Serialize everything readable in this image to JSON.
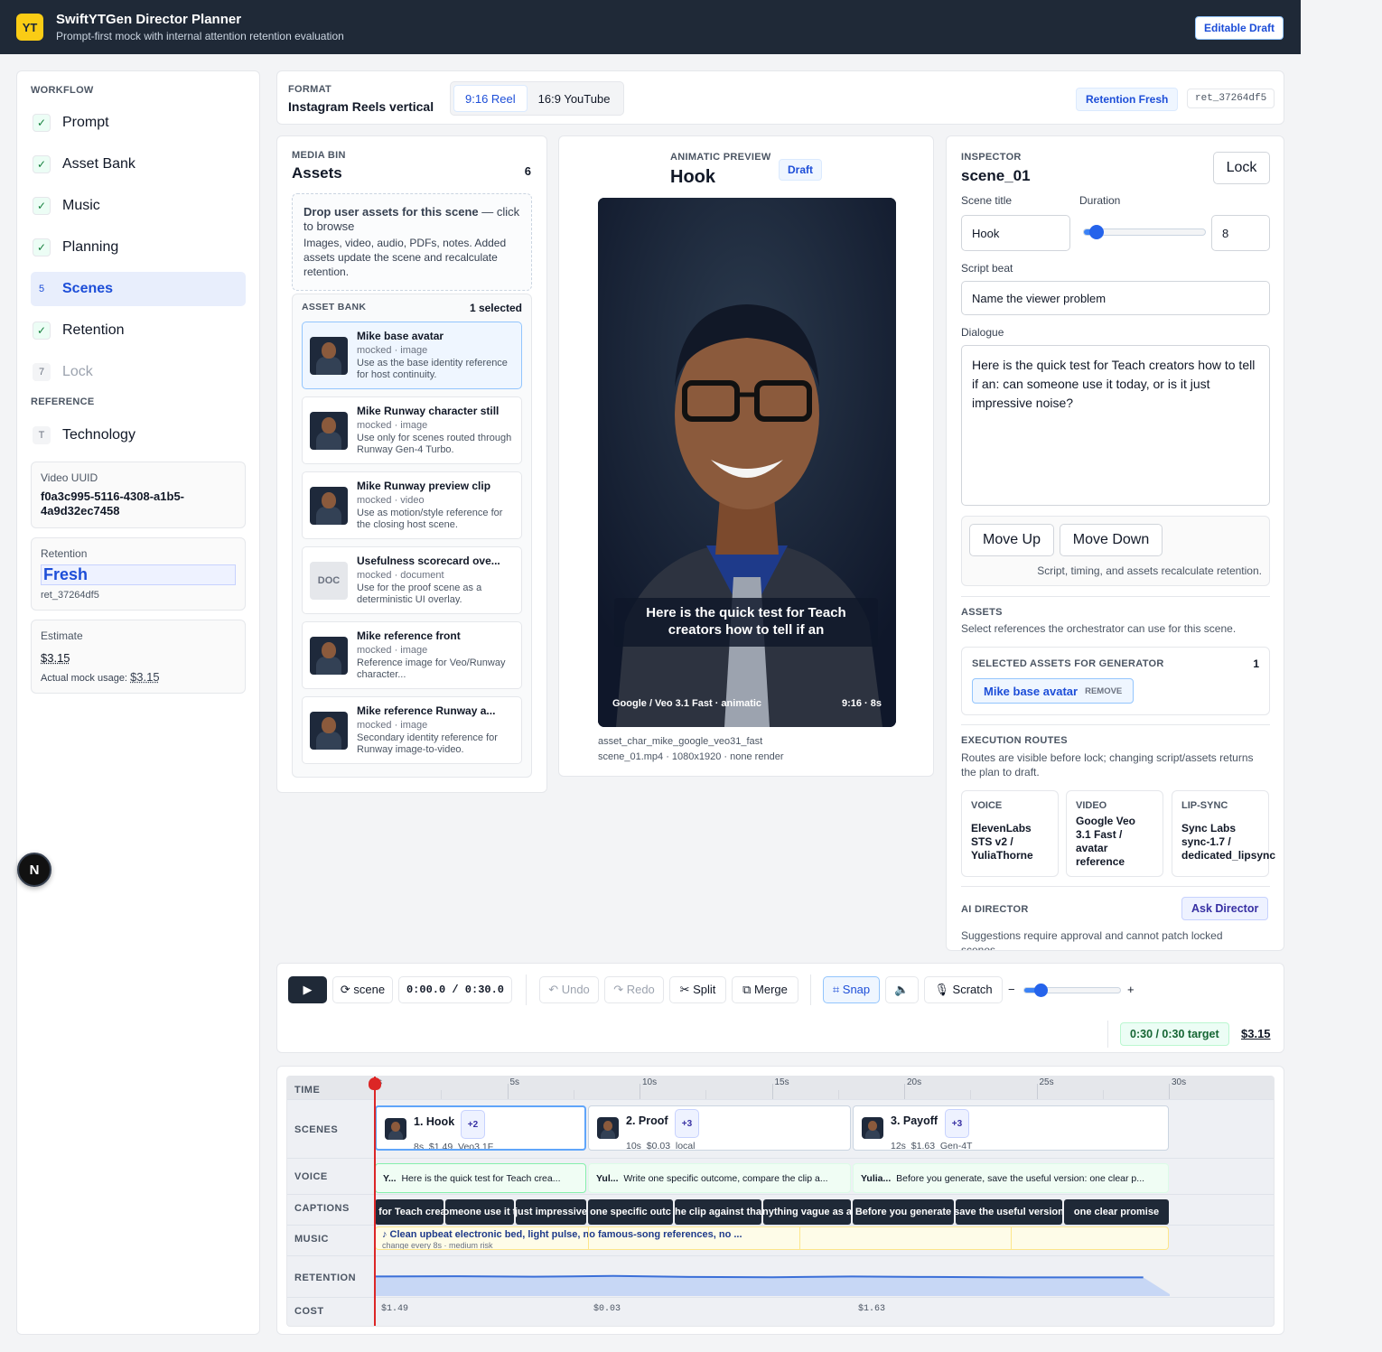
{
  "header": {
    "logo": "YT",
    "title": "SwiftYTGen Director Planner",
    "subtitle": "Prompt-first mock with internal attention retention evaluation",
    "badge": "Editable Draft"
  },
  "sidebar": {
    "workflow_label": "WORKFLOW",
    "items": [
      {
        "mark": "✓",
        "label": "Prompt"
      },
      {
        "mark": "✓",
        "label": "Asset Bank"
      },
      {
        "mark": "✓",
        "label": "Music"
      },
      {
        "mark": "✓",
        "label": "Planning"
      },
      {
        "mark": "5",
        "label": "Scenes"
      },
      {
        "mark": "✓",
        "label": "Retention"
      },
      {
        "mark": "7",
        "label": "Lock"
      }
    ],
    "reference_label": "REFERENCE",
    "reference_item": {
      "mark": "T",
      "label": "Technology"
    },
    "uuid_label": "Video UUID",
    "uuid": "f0a3c995-5116-4308-a1b5-4a9d32ec7458",
    "retention_label": "Retention",
    "retention_value": "Fresh",
    "retention_id": "ret_37264df5",
    "estimate_label": "Estimate",
    "estimate_value": "$3.15",
    "actual_label": "Actual mock usage:",
    "actual_value": "$3.15",
    "fab": "N"
  },
  "format": {
    "label": "FORMAT",
    "value": "Instagram Reels vertical",
    "options": [
      "9:16 Reel",
      "16:9 YouTube"
    ],
    "retention_badge": "Retention Fresh",
    "retention_id": "ret_37264df5"
  },
  "media": {
    "label": "MEDIA BIN",
    "title": "Assets",
    "count": "6",
    "drop_title": "Drop user assets for this scene",
    "drop_link": " — click to browse",
    "drop_desc": "Images, video, audio, PDFs, notes. Added assets update the scene and recalculate retention.",
    "bank_label": "ASSET BANK",
    "bank_selected": "1 selected",
    "assets": [
      {
        "title": "Mike base avatar",
        "meta": "mocked · image",
        "desc": "Use as the base identity reference for host continuity."
      },
      {
        "title": "Mike Runway character still",
        "meta": "mocked · image",
        "desc": "Use only for scenes routed through Runway Gen-4 Turbo."
      },
      {
        "title": "Mike Runway preview clip",
        "meta": "mocked · video",
        "desc": "Use as motion/style reference for the closing host scene."
      },
      {
        "title": "Usefulness scorecard ove...",
        "meta": "mocked · document",
        "desc": "Use for the proof scene as a deterministic UI overlay.",
        "doc": "DOC"
      },
      {
        "title": "Mike reference front",
        "meta": "mocked · image",
        "desc": "Reference image for Veo/Runway character..."
      },
      {
        "title": "Mike reference Runway a...",
        "meta": "mocked · image",
        "desc": "Secondary identity reference for Runway image-to-video."
      }
    ]
  },
  "preview": {
    "label": "ANIMATIC PREVIEW",
    "title": "Hook",
    "badge": "Draft",
    "caption": "Here is the quick test for Teach creators how to tell if an",
    "footer_left": "Google / Veo 3.1 Fast · animatic",
    "footer_right": "9:16 · 8s",
    "file1": "asset_char_mike_google_veo31_fast",
    "file2": "scene_01.mp4 · 1080x1920 · none render"
  },
  "inspector": {
    "label": "INSPECTOR",
    "scene_id": "scene_01",
    "lock": "Lock",
    "scene_title_label": "Scene title",
    "duration_label": "Duration",
    "scene_title": "Hook",
    "duration": "8",
    "script_label": "Script beat",
    "script": "Name the viewer problem",
    "dialogue_label": "Dialogue",
    "dialogue": "Here is the quick test for Teach creators how to tell if an: can someone use it today, or is it just impressive noise?",
    "move_up": "Move Up",
    "move_down": "Move Down",
    "recalc_note": "Script, timing, and assets recalculate retention.",
    "assets_label": "ASSETS",
    "assets_desc": "Select references the orchestrator can use for this scene.",
    "selected_label": "SELECTED ASSETS FOR GENERATOR",
    "selected_count": "1",
    "chip": "Mike base avatar",
    "chip_remove": "REMOVE",
    "routes_label": "EXECUTION ROUTES",
    "routes_desc": "Routes are visible before lock; changing script/assets returns the plan to draft.",
    "routes": [
      {
        "k": "VOICE",
        "v": "ElevenLabs STS v2 / YuliaThorne"
      },
      {
        "k": "VIDEO",
        "v": "Google Veo 3.1 Fast / avatar reference"
      },
      {
        "k": "LIP-SYNC",
        "v": "Sync Labs sync-1.7 / dedicated_lipsync"
      }
    ],
    "ai_label": "AI DIRECTOR",
    "ask": "Ask Director",
    "ai_desc": "Suggestions require approval and cannot patch locked scenes."
  },
  "controls": {
    "play": "▶",
    "scene": "⟳ scene",
    "time": "0:00.0 / 0:30.0",
    "undo": "↶ Undo",
    "redo": "↷ Redo",
    "split": "✂ Split",
    "merge": "⧉ Merge",
    "snap": "⌗ Snap",
    "mute": "🔈",
    "scratch": "🎙 Scratch",
    "minus": "−",
    "plus": "+",
    "zoom": 0.17,
    "target": "0:30 / 0:30 target",
    "cost": "$3.15"
  },
  "timeline": {
    "rows": [
      "TIME",
      "SCENES",
      "VOICE",
      "CAPTIONS",
      "MUSIC",
      "RETENTION",
      "COST"
    ],
    "ticks": [
      "s",
      "5s",
      "10s",
      "15s",
      "20s",
      "25s",
      "30s"
    ],
    "scenes": [
      {
        "title": "1. Hook",
        "badge": "+2",
        "meta": "8s  $1.49  Veo3.1F"
      },
      {
        "title": "2. Proof",
        "badge": "+3",
        "meta": "10s  $0.03  local"
      },
      {
        "title": "3. Payoff",
        "badge": "+3",
        "meta": "12s  $1.63  Gen-4T"
      }
    ],
    "voice": [
      {
        "who": "Y...",
        "text": "Here is the quick test for Teach crea..."
      },
      {
        "who": "Yul...",
        "text": "Write one specific outcome, compare the clip a..."
      },
      {
        "who": "Yulia...",
        "text": "Before you generate, save the useful version: one clear p..."
      }
    ],
    "captions": [
      "t for Teach crea",
      "omeone use it t",
      "just impressive",
      "one specific outc",
      "he clip against tha",
      "nything vague as a",
      "Before you generate",
      "save the useful version",
      "one clear promise"
    ],
    "music_title": "♪ Clean upbeat electronic bed, light pulse, no famous-song references, no ...",
    "music_meta": "change every 8s · medium risk",
    "retention_curve": [
      {
        "t": 0,
        "v": 0.72
      },
      {
        "t": 3,
        "v": 0.73
      },
      {
        "t": 6,
        "v": 0.71
      },
      {
        "t": 9,
        "v": 0.74
      },
      {
        "t": 12,
        "v": 0.7
      },
      {
        "t": 15,
        "v": 0.69
      },
      {
        "t": 18,
        "v": 0.72
      },
      {
        "t": 21,
        "v": 0.7
      },
      {
        "t": 24,
        "v": 0.68
      },
      {
        "t": 27,
        "v": 0.68
      },
      {
        "t": 29,
        "v": 0.68
      },
      {
        "t": 30,
        "v": 0.0
      }
    ],
    "costs": [
      "$1.49",
      "$0.03",
      "$1.63"
    ]
  },
  "colors": {
    "accent": "#1d4ed8",
    "dark": "#1f2937",
    "playhead": "#dc2626"
  }
}
